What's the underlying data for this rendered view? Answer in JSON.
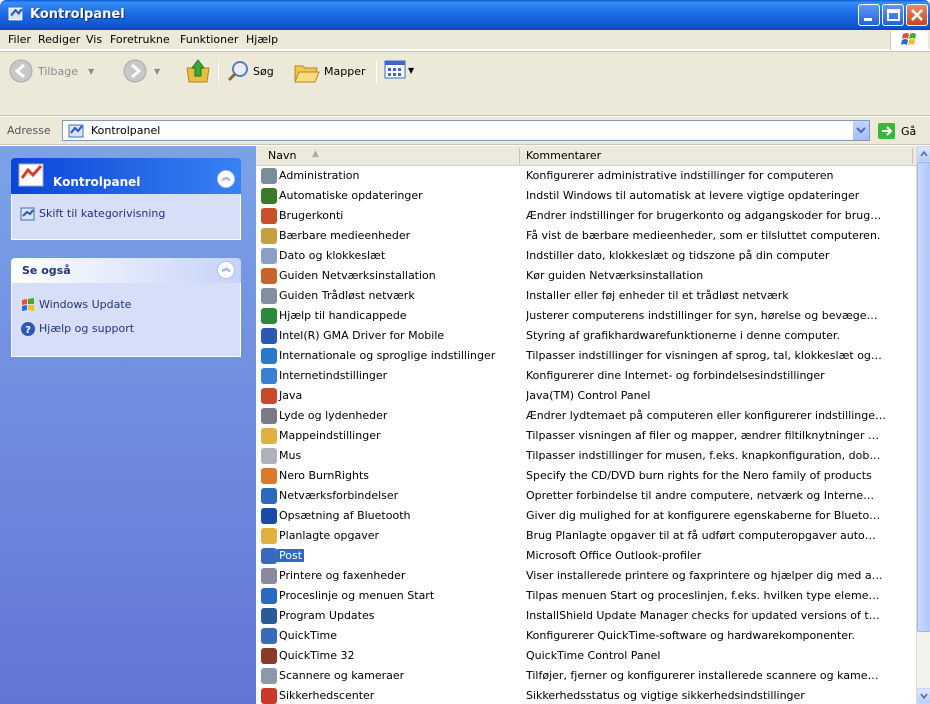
{
  "window": {
    "title": "Kontrolpanel"
  },
  "menu": [
    "Filer",
    "Rediger",
    "Vis",
    "Foretrukne",
    "Funktioner",
    "Hjælp"
  ],
  "toolbar": {
    "back": "Tilbage",
    "search": "Søg",
    "folders": "Mapper"
  },
  "address": {
    "label": "Adresse",
    "value": "Kontrolpanel",
    "go": "Gå"
  },
  "left": {
    "panel_title": "Kontrolpanel",
    "switch_view": "Skift til kategorivisning",
    "see_also_title": "Se også",
    "see_also": [
      "Windows Update",
      "Hjælp og support"
    ]
  },
  "columns": {
    "name": "Navn",
    "comment": "Kommentarer"
  },
  "items": [
    {
      "name": "Administration",
      "comment": "Konfigurerer administrative indstillinger for computeren",
      "icon": "administration-icon",
      "color": "#7a8d99"
    },
    {
      "name": "Automatiske opdateringer",
      "comment": "Indstil Windows til automatisk at levere vigtige opdateringer",
      "icon": "windows-update-icon",
      "color": "#3a7a2a"
    },
    {
      "name": "Brugerkonti",
      "comment": "Ændrer indstillinger for brugerkonto og adgangskoder for brug…",
      "icon": "users-icon",
      "color": "#c8502a"
    },
    {
      "name": "Bærbare medieenheder",
      "comment": "Få vist de bærbare medieenheder, som er tilsluttet computeren.",
      "icon": "media-device-icon",
      "color": "#c5a040"
    },
    {
      "name": "Dato og klokkeslæt",
      "comment": "Indstiller dato, klokkeslæt og tidszone på din computer",
      "icon": "clock-icon",
      "color": "#8aa0c8"
    },
    {
      "name": "Guiden Netværksinstallation",
      "comment": "Kør guiden Netværksinstallation",
      "icon": "network-wizard-icon",
      "color": "#c8642a"
    },
    {
      "name": "Guiden Trådløst netværk",
      "comment": "Installer eller føj enheder til et trådløst netværk",
      "icon": "wireless-icon",
      "color": "#8090a0"
    },
    {
      "name": "Hjælp til handicappede",
      "comment": "Justerer computerens indstillinger for syn, hørelse og bevæge…",
      "icon": "accessibility-icon",
      "color": "#2a8a3a"
    },
    {
      "name": "Intel(R) GMA Driver for Mobile",
      "comment": "Styring af grafikhardwarefunktionerne i denne computer.",
      "icon": "intel-icon",
      "color": "#2a5ab0"
    },
    {
      "name": "Internationale og sproglige indstillinger",
      "comment": "Tilpasser indstillinger for visningen af sprog, tal, klokkeslæt og…",
      "icon": "globe-icon",
      "color": "#2a7ac8"
    },
    {
      "name": "Internetindstillinger",
      "comment": "Konfigurerer dine Internet- og forbindelsesindstillinger",
      "icon": "internet-icon",
      "color": "#3a80d0"
    },
    {
      "name": "Java",
      "comment": "Java(TM) Control Panel",
      "icon": "java-icon",
      "color": "#c84a2a"
    },
    {
      "name": "Lyde og lydenheder",
      "comment": "Ændrer lydtemaet på computeren eller konfigurerer indstillinge…",
      "icon": "speaker-icon",
      "color": "#7a7a8a"
    },
    {
      "name": "Mappeindstillinger",
      "comment": "Tilpasser visningen af filer og mapper, ændrer filtilknytninger …",
      "icon": "folder-icon",
      "color": "#e0b040"
    },
    {
      "name": "Mus",
      "comment": "Tilpasser indstillinger for musen, f.eks. knapkonfiguration, dob…",
      "icon": "mouse-icon",
      "color": "#b0b0b8"
    },
    {
      "name": "Nero BurnRights",
      "comment": "Specify the CD/DVD burn rights for the Nero family of products",
      "icon": "nero-icon",
      "color": "#d87a2a"
    },
    {
      "name": "Netværksforbindelser",
      "comment": "Opretter forbindelse til andre computere, netværk og Interne…",
      "icon": "network-icon",
      "color": "#2a6ab8"
    },
    {
      "name": "Opsætning af Bluetooth",
      "comment": "Giver dig mulighed for at konfigurere egenskaberne for Blueto…",
      "icon": "bluetooth-icon",
      "color": "#1a4aa8"
    },
    {
      "name": "Planlagte opgaver",
      "comment": "Brug Planlagte opgaver til at få udført computeropgaver auto…",
      "icon": "scheduled-tasks-icon",
      "color": "#e0b040"
    },
    {
      "name": "Post",
      "comment": "Microsoft Office Outlook-profiler",
      "icon": "mail-icon",
      "color": "#3a6ac0",
      "selected": true
    },
    {
      "name": "Printere og faxenheder",
      "comment": "Viser installerede printere og faxprintere og hjælper dig med a…",
      "icon": "printer-icon",
      "color": "#8a8a9a"
    },
    {
      "name": "Proceslinje og menuen Start",
      "comment": "Tilpas menuen Start og proceslinjen, f.eks. hvilken type eleme…",
      "icon": "taskbar-icon",
      "color": "#2a6ac0"
    },
    {
      "name": "Program Updates",
      "comment": "InstallShield Update Manager checks for updated versions of t…",
      "icon": "program-updates-icon",
      "color": "#2a5a98"
    },
    {
      "name": "QuickTime",
      "comment": "Konfigurerer QuickTime-software og hardwarekomponenter.",
      "icon": "quicktime-icon",
      "color": "#3a6ab8"
    },
    {
      "name": "QuickTime 32",
      "comment": "QuickTime Control Panel",
      "icon": "quicktime32-icon",
      "color": "#8a3a2a"
    },
    {
      "name": "Scannere og kameraer",
      "comment": "Tilføjer, fjerner og konfigurerer installerede scannere og kame…",
      "icon": "scanner-icon",
      "color": "#8a9aa8"
    },
    {
      "name": "Sikkerhedscenter",
      "comment": "Sikkerhedsstatus og vigtige sikkerhedsindstillinger",
      "icon": "security-center-icon",
      "color": "#c83a2a"
    }
  ]
}
